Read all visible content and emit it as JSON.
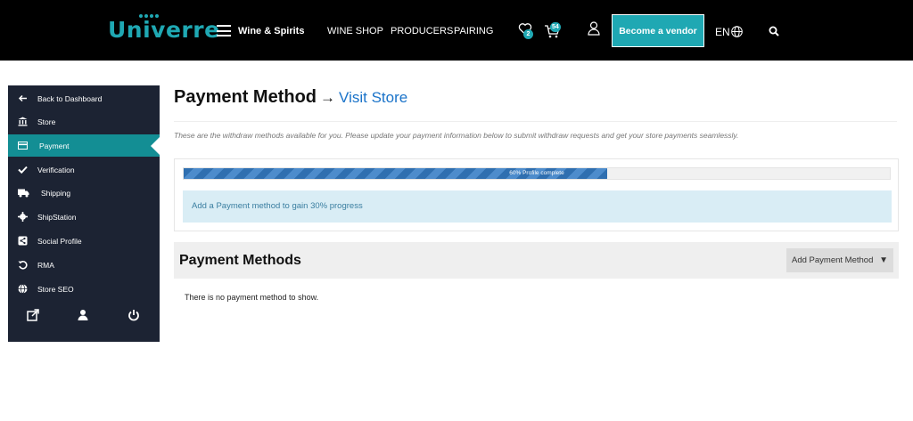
{
  "header": {
    "logo": "Univerre",
    "menu_label": "Wine & Spirits",
    "nav": [
      "WINE SHOP",
      "PRODUCERS",
      "PAIRING"
    ],
    "wishlist_count": "2",
    "cart_count": "54",
    "vendor_button": "Become a vendor",
    "language": "EN",
    "brand_color": "#1fa8b3"
  },
  "sidebar": {
    "items": [
      {
        "label": "Back to Dashboard",
        "icon": "arrow-left-icon"
      },
      {
        "label": "Store",
        "icon": "bank-icon"
      },
      {
        "label": "Payment",
        "icon": "credit-card-icon",
        "active": true
      },
      {
        "label": "Verification",
        "icon": "check-icon"
      },
      {
        "label": "Shipping",
        "icon": "truck-icon"
      },
      {
        "label": "ShipStation",
        "icon": "gear-icon"
      },
      {
        "label": "Social Profile",
        "icon": "share-icon"
      },
      {
        "label": "RMA",
        "icon": "undo-icon"
      },
      {
        "label": "Store SEO",
        "icon": "globe-icon"
      }
    ],
    "bottom_icons": [
      "external-link-icon",
      "user-icon",
      "power-icon"
    ],
    "active_color": "#138e94"
  },
  "main": {
    "title": "Payment Method",
    "arrow": "→",
    "visit_store": "Visit Store",
    "description": "These are the withdraw methods available for you. Please update your payment information below to submit withdraw requests and get your store payments seamlessly.",
    "progress_percent": 60,
    "progress_text": "60% Profile complete",
    "progress_hint": "Add a Payment method to gain 30% progress",
    "methods_heading": "Payment Methods",
    "add_method_label": "Add Payment Method",
    "caret": "▼",
    "empty_text": "There is no payment method to show."
  }
}
